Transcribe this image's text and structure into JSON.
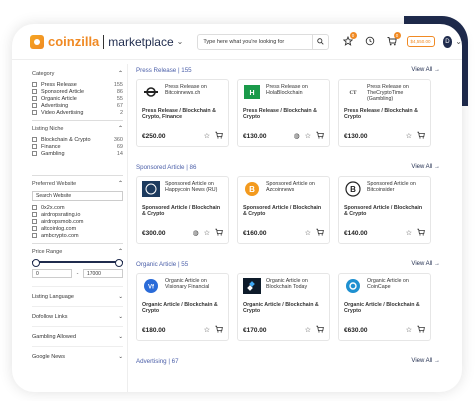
{
  "topbar": {
    "brand": "coinzilla",
    "product": "marketplace",
    "search_placeholder": "Type here what you're looking for",
    "favorites_count": "0",
    "cart_count": "0",
    "balance": "$4,550.00",
    "avatar_initial": "D"
  },
  "sidebar": {
    "category_title": "Category",
    "categories": [
      {
        "label": "Press Release",
        "count": "155"
      },
      {
        "label": "Sponsored Article",
        "count": "86"
      },
      {
        "label": "Organic Article",
        "count": "55"
      },
      {
        "label": "Advertising",
        "count": "67"
      },
      {
        "label": "Video Advertising",
        "count": "2"
      }
    ],
    "niche_title": "Listing Niche",
    "niches": [
      {
        "label": "Blockchain & Crypto",
        "count": "360"
      },
      {
        "label": "Finance",
        "count": "69"
      },
      {
        "label": "Gambling",
        "count": "14"
      }
    ],
    "preferred_title": "Preferred Website",
    "preferred_search": "Search Website",
    "websites": [
      "0x2x.com",
      "airdropsrating.io",
      "airdropsmob.com",
      "altcoinlog.com",
      "ambcrypto.com"
    ],
    "price_title": "Price Range",
    "price_min": "0",
    "price_max": "17000",
    "collapsed": [
      "Listing Language",
      "Dofollow Links",
      "Gambling Allowed",
      "Google News"
    ]
  },
  "main": {
    "view_all": "View All →",
    "sections": [
      {
        "title": "Press Release | 155",
        "cards": [
          {
            "title": "Press Release on Bitcoinnews.ch",
            "category": "Press Release / Blockchain & Crypto, Finance",
            "price": "€250.00",
            "thumb": "bitcoinnews",
            "color": "#222222"
          },
          {
            "title": "Press Release on HolaBlockchain",
            "category": "Press Release / Blockchain & Crypto",
            "price": "€130.00",
            "thumb": "hola",
            "color": "#1a9a4a"
          },
          {
            "title": "Press Release on TheCryptoTime (Gambling)",
            "category": "Press Release / Blockchain & Crypto",
            "price": "€130.00",
            "thumb": "cryptotime",
            "color": "#333333"
          }
        ]
      },
      {
        "title": "Sponsored Article | 86",
        "cards": [
          {
            "title": "Sponsored Article on Happycoin News (RU)",
            "category": "Sponsored Article / Blockchain & Crypto",
            "price": "€300.00",
            "thumb": "happycoin",
            "color": "#1c3a5e"
          },
          {
            "title": "Sponsored Article on Azcoinnews",
            "category": "Sponsored Article / Blockchain & Crypto",
            "price": "€160.00",
            "thumb": "azcoin",
            "color": "#f39a1e"
          },
          {
            "title": "Sponsored Article on Bitcoinsider",
            "category": "Sponsored Article / Blockchain & Crypto",
            "price": "€140.00",
            "thumb": "bitcoinsider",
            "color": "#222222"
          }
        ]
      },
      {
        "title": "Organic Article | 55",
        "cards": [
          {
            "title": "Organic Article on Visionary Financial",
            "category": "Organic Article / Blockchain & Crypto",
            "price": "€180.00",
            "thumb": "visionary",
            "color": "#2a6bd8"
          },
          {
            "title": "Organic Article on Blockchain Today",
            "category": "Organic Article / Blockchain & Crypto",
            "price": "€170.00",
            "thumb": "bctoday",
            "color": "#0d1b2a"
          },
          {
            "title": "Organic Article on CoinCape",
            "category": "Organic Article / Blockchain & Crypto",
            "price": "€630.00",
            "thumb": "coincape",
            "color": "#1e90d0"
          }
        ]
      }
    ],
    "last_section_title": "Advertising | 67"
  }
}
